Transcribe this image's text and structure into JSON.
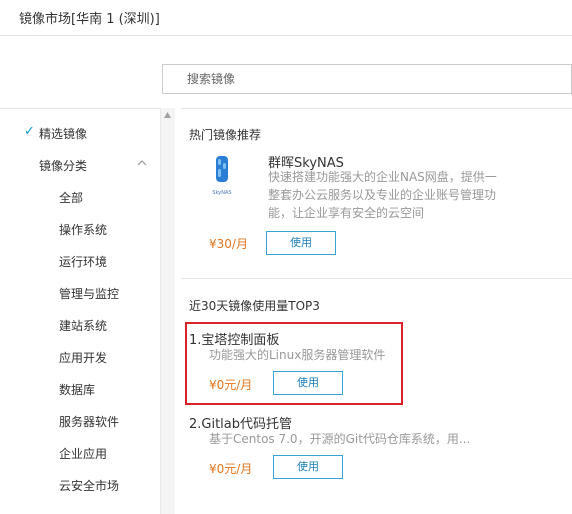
{
  "window": {
    "title": "镜像市场[华南 1 (深圳)]"
  },
  "search": {
    "placeholder": "搜索镜像"
  },
  "sidebar": {
    "selected": "精选镜像",
    "group": "镜像分类",
    "items": [
      "全部",
      "操作系统",
      "运行环境",
      "管理与监控",
      "建站系统",
      "应用开发",
      "数据库",
      "服务器软件",
      "企业应用",
      "云安全市场"
    ]
  },
  "hot": {
    "title": "热门镜像推荐",
    "logo_text": "SkyNAS",
    "name": "群晖SkyNAS",
    "desc": "快速搭建功能强大的企业NAS网盘，提供一整套办公云服务以及专业的企业账号管理功能，让企业享有安全的云空间",
    "price": "¥30/月",
    "button": "使用"
  },
  "top3": {
    "title": "近30天镜像使用量TOP3",
    "items": [
      {
        "name": "1.宝塔控制面板",
        "desc": "功能强大的Linux服务器管理软件",
        "price": "¥0元/月",
        "button": "使用"
      },
      {
        "name": "2.Gitlab代码托管",
        "desc": "基于Centos 7.0，开源的Git代码仓库系统，用...",
        "price": "¥0元/月",
        "button": "使用"
      }
    ]
  },
  "colors": {
    "accent": "#0c9bd8",
    "price": "#e1751f",
    "highlight": "#d9222a"
  }
}
